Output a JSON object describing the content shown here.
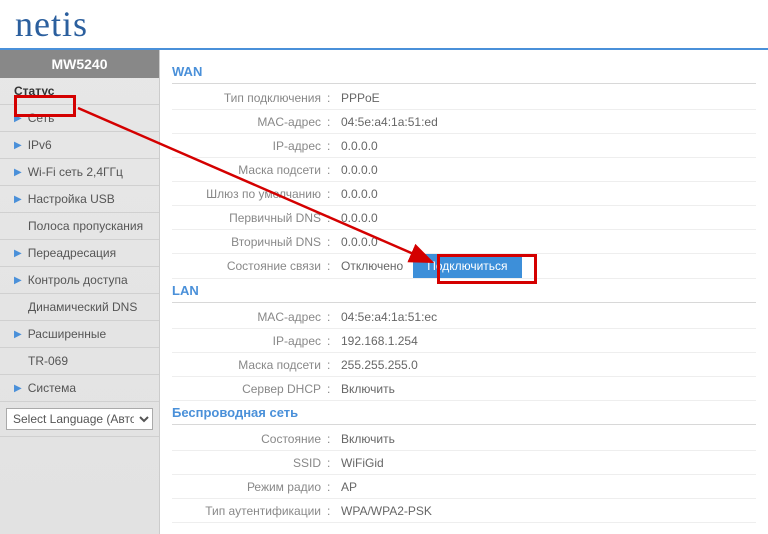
{
  "brand": "netis",
  "model": "MW5240",
  "nav": {
    "status": "Статус",
    "net": "Сеть",
    "ipv6": "IPv6",
    "wifi24": "Wi-Fi сеть 2,4ГГц",
    "usb": "Настройка USB",
    "bandwidth": "Полоса пропускания",
    "forward": "Переадресация",
    "access": "Контроль доступа",
    "ddns": "Динамический DNS",
    "advanced": "Расширенные",
    "tr069": "TR-069",
    "system": "Система"
  },
  "lang_label": "Select Language (Авто)",
  "sections": {
    "wan": "WAN",
    "lan": "LAN",
    "wifi": "Беспроводная сеть"
  },
  "wan": {
    "conn_type_label": "Тип подключения",
    "conn_type": "PPPoE",
    "mac_label": "MAC-адрес",
    "mac": "04:5e:a4:1a:51:ed",
    "ip_label": "IP-адрес",
    "ip": "0.0.0.0",
    "mask_label": "Маска подсети",
    "mask": "0.0.0.0",
    "gw_label": "Шлюз по умолчанию",
    "gw": "0.0.0.0",
    "dns1_label": "Первичный DNS",
    "dns1": "0.0.0.0",
    "dns2_label": "Вторичный DNS",
    "dns2": "0.0.0.0",
    "state_label": "Состояние связи",
    "state": "Отключено",
    "connect_btn": "Подключиться"
  },
  "lan": {
    "mac_label": "MAC-адрес",
    "mac": "04:5e:a4:1a:51:ec",
    "ip_label": "IP-адрес",
    "ip": "192.168.1.254",
    "mask_label": "Маска подсети",
    "mask": "255.255.255.0",
    "dhcp_label": "Сервер DHCP",
    "dhcp": "Включить"
  },
  "wifi": {
    "state_label": "Состояние",
    "state": "Включить",
    "ssid_label": "SSID",
    "ssid": "WiFiGid",
    "mode_label": "Режим радио",
    "mode": "AP",
    "auth_label": "Тип аутентификации",
    "auth": "WPA/WPA2-PSK"
  }
}
